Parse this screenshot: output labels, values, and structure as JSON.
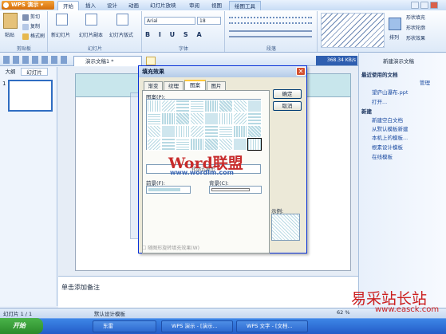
{
  "app": {
    "brand": "WPS 演示"
  },
  "menu_tabs": [
    "开始",
    "插入",
    "设计",
    "动画",
    "幻灯片放映",
    "审阅",
    "视图",
    "绘图工具"
  ],
  "ribbon": {
    "clipboard": {
      "paste": "粘贴",
      "cut": "剪切",
      "copy": "复制",
      "format_painter": "格式刷",
      "label": "剪贴板"
    },
    "slides": {
      "new": "新幻灯片",
      "copy": "幻灯片副本",
      "layout": "幻灯片版式",
      "label": "幻灯片"
    },
    "font": {
      "name": "Arial",
      "size": "18",
      "label": "字体"
    },
    "paragraph": {
      "label": "段落"
    },
    "draw": {
      "fill": "形状填充",
      "outline": "形状轮廓",
      "effect": "形状效果",
      "arrange": "排列"
    }
  },
  "doc_tab": {
    "title": "演示文稿1 *"
  },
  "network": {
    "speed": "368.34 KB/s"
  },
  "left_panel": {
    "tabs": [
      "大纲",
      "幻灯片"
    ],
    "slide_number": "1"
  },
  "notes": {
    "placeholder": "单击添加备注"
  },
  "task_pane": {
    "title": "新建演示文稿",
    "recent_heading": "最近使用的文档",
    "manage": "管理",
    "recent": [
      "望庐山瀑布.ppt",
      "打开..."
    ],
    "new_heading": "新建",
    "new_items": [
      "新建空白文档",
      "从默认模板新建",
      "本机上的模板...",
      "根素设计模板",
      "在线模板"
    ]
  },
  "dialog": {
    "title": "填充效果",
    "tabs": [
      "渐变",
      "纹理",
      "图案",
      "图片"
    ],
    "active_tab": "图案",
    "pattern_label": "图案(P):",
    "pattern_name": "轮廓式菱形",
    "foreground_label": "前景(F):",
    "background_label": "背景(C):",
    "sample_label": "示例:",
    "rotate_label": "随图形旋转填充效果(W)",
    "ok": "确定",
    "cancel": "取消"
  },
  "watermark": {
    "title": "Word联盟",
    "url": "www.wordlm.com"
  },
  "status": {
    "slide": "幻灯片 1 / 1",
    "template": "默认设计模板",
    "zoom": "62 %"
  },
  "taskbar": {
    "start": "开始",
    "items": [
      "东雷",
      "WPS 演示 - [演示...",
      "WPS 文字 - [文档..."
    ]
  },
  "corner_watermark": {
    "title": "易采站长站",
    "url": "www.easck.com"
  }
}
